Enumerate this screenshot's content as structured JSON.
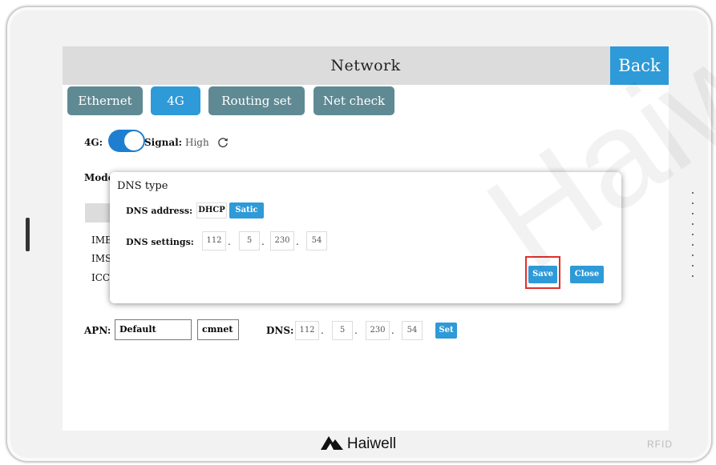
{
  "device": {
    "brand": "Haiwell",
    "rfid_label": "RFID"
  },
  "header": {
    "title": "Network",
    "back_label": "Back"
  },
  "tabs": [
    {
      "label": "Ethernet",
      "active": false
    },
    {
      "label": "4G",
      "active": true
    },
    {
      "label": "Routing set",
      "active": false
    },
    {
      "label": "Net check",
      "active": false
    }
  ],
  "status": {
    "toggle_label": "4G:",
    "toggle_on": true,
    "signal_label": "Signal:",
    "signal_value": "High",
    "refresh_icon": "refresh-icon"
  },
  "mode_label": "Mode",
  "info_labels": [
    "IME",
    "IMS",
    "ICC"
  ],
  "apn": {
    "label": "APN:",
    "value": "Default",
    "operator": "cmnet"
  },
  "dns_row": {
    "label": "DNS:",
    "octets": [
      "112",
      "5",
      "230",
      "54"
    ],
    "set_label": "Set"
  },
  "dns_dialog": {
    "title": "DNS type",
    "address_label": "DNS address:",
    "options": [
      {
        "label": "DHCP",
        "selected": false
      },
      {
        "label": "Satic",
        "selected": true
      }
    ],
    "settings_label": "DNS settings:",
    "octets": [
      "112",
      "5",
      "230",
      "54"
    ],
    "save_label": "Save",
    "close_label": "Close"
  },
  "watermark": "Haiwell",
  "colors": {
    "accent": "#2e9ad7",
    "tab_inactive": "#5f8a94",
    "highlight": "#e0302b",
    "toggle": "#1e7fd0"
  }
}
